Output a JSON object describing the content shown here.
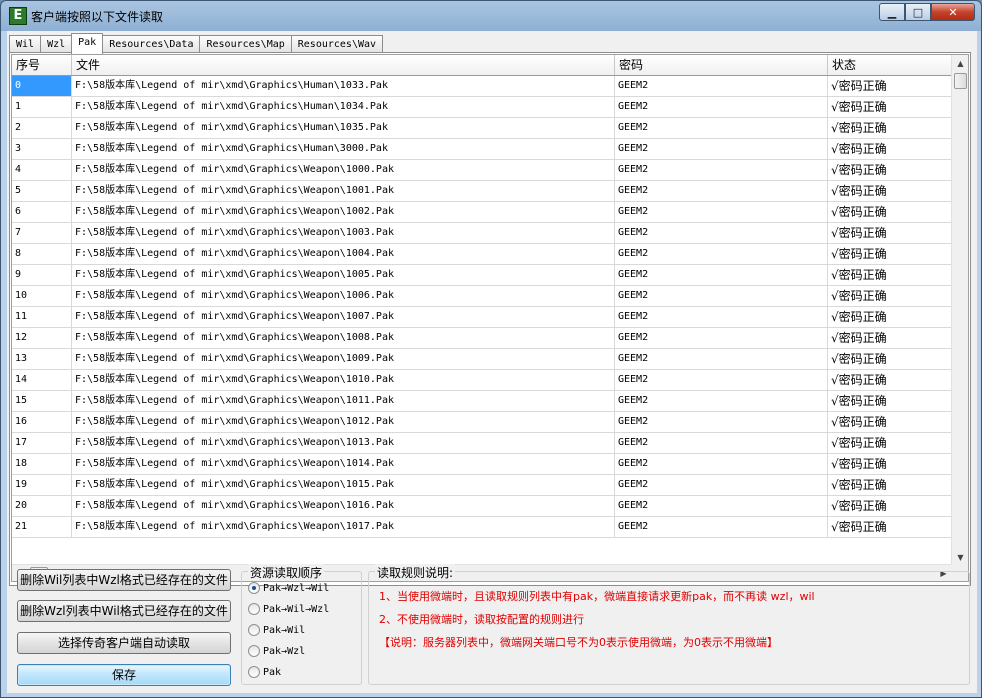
{
  "window": {
    "title": "客户端按照以下文件读取",
    "min": "▁",
    "max": "□",
    "close": "✕"
  },
  "tabs": [
    {
      "label": "Wil",
      "active": false
    },
    {
      "label": "Wzl",
      "active": false
    },
    {
      "label": "Pak",
      "active": true
    },
    {
      "label": "Resources\\Data",
      "active": false
    },
    {
      "label": "Resources\\Map",
      "active": false
    },
    {
      "label": "Resources\\Wav",
      "active": false
    }
  ],
  "grid": {
    "headers": [
      "序号",
      "文件",
      "密码",
      "状态"
    ],
    "rows": [
      [
        "0",
        "F:\\58版本库\\Legend of mir\\xmd\\Graphics\\Human\\1033.Pak",
        "GEEM2",
        "√密码正确"
      ],
      [
        "1",
        "F:\\58版本库\\Legend of mir\\xmd\\Graphics\\Human\\1034.Pak",
        "GEEM2",
        "√密码正确"
      ],
      [
        "2",
        "F:\\58版本库\\Legend of mir\\xmd\\Graphics\\Human\\1035.Pak",
        "GEEM2",
        "√密码正确"
      ],
      [
        "3",
        "F:\\58版本库\\Legend of mir\\xmd\\Graphics\\Human\\3000.Pak",
        "GEEM2",
        "√密码正确"
      ],
      [
        "4",
        "F:\\58版本库\\Legend of mir\\xmd\\Graphics\\Weapon\\1000.Pak",
        "GEEM2",
        "√密码正确"
      ],
      [
        "5",
        "F:\\58版本库\\Legend of mir\\xmd\\Graphics\\Weapon\\1001.Pak",
        "GEEM2",
        "√密码正确"
      ],
      [
        "6",
        "F:\\58版本库\\Legend of mir\\xmd\\Graphics\\Weapon\\1002.Pak",
        "GEEM2",
        "√密码正确"
      ],
      [
        "7",
        "F:\\58版本库\\Legend of mir\\xmd\\Graphics\\Weapon\\1003.Pak",
        "GEEM2",
        "√密码正确"
      ],
      [
        "8",
        "F:\\58版本库\\Legend of mir\\xmd\\Graphics\\Weapon\\1004.Pak",
        "GEEM2",
        "√密码正确"
      ],
      [
        "9",
        "F:\\58版本库\\Legend of mir\\xmd\\Graphics\\Weapon\\1005.Pak",
        "GEEM2",
        "√密码正确"
      ],
      [
        "10",
        "F:\\58版本库\\Legend of mir\\xmd\\Graphics\\Weapon\\1006.Pak",
        "GEEM2",
        "√密码正确"
      ],
      [
        "11",
        "F:\\58版本库\\Legend of mir\\xmd\\Graphics\\Weapon\\1007.Pak",
        "GEEM2",
        "√密码正确"
      ],
      [
        "12",
        "F:\\58版本库\\Legend of mir\\xmd\\Graphics\\Weapon\\1008.Pak",
        "GEEM2",
        "√密码正确"
      ],
      [
        "13",
        "F:\\58版本库\\Legend of mir\\xmd\\Graphics\\Weapon\\1009.Pak",
        "GEEM2",
        "√密码正确"
      ],
      [
        "14",
        "F:\\58版本库\\Legend of mir\\xmd\\Graphics\\Weapon\\1010.Pak",
        "GEEM2",
        "√密码正确"
      ],
      [
        "15",
        "F:\\58版本库\\Legend of mir\\xmd\\Graphics\\Weapon\\1011.Pak",
        "GEEM2",
        "√密码正确"
      ],
      [
        "16",
        "F:\\58版本库\\Legend of mir\\xmd\\Graphics\\Weapon\\1012.Pak",
        "GEEM2",
        "√密码正确"
      ],
      [
        "17",
        "F:\\58版本库\\Legend of mir\\xmd\\Graphics\\Weapon\\1013.Pak",
        "GEEM2",
        "√密码正确"
      ],
      [
        "18",
        "F:\\58版本库\\Legend of mir\\xmd\\Graphics\\Weapon\\1014.Pak",
        "GEEM2",
        "√密码正确"
      ],
      [
        "19",
        "F:\\58版本库\\Legend of mir\\xmd\\Graphics\\Weapon\\1015.Pak",
        "GEEM2",
        "√密码正确"
      ],
      [
        "20",
        "F:\\58版本库\\Legend of mir\\xmd\\Graphics\\Weapon\\1016.Pak",
        "GEEM2",
        "√密码正确"
      ],
      [
        "21",
        "F:\\58版本库\\Legend of mir\\xmd\\Graphics\\Weapon\\1017.Pak",
        "GEEM2",
        "√密码正确"
      ]
    ],
    "selected_row": 0
  },
  "buttons": {
    "delete_wil": "删除Wil列表中Wzl格式已经存在的文件",
    "delete_wzl": "删除Wzl列表中Wil格式已经存在的文件",
    "auto_read": "选择传奇客户端自动读取",
    "save": "保存"
  },
  "order_group": {
    "title": "资源读取顺序",
    "options": [
      "Pak→Wzl→Wil",
      "Pak→Wil→Wzl",
      "Pak→Wil",
      "Pak→Wzl",
      "Pak"
    ],
    "selected": 0
  },
  "rules_group": {
    "title": "读取规则说明:",
    "lines": [
      "1、当使用微端时，且读取规则列表中有pak，微端直接请求更新pak，而不再读 wzl，wil",
      "2、不使用微端时，读取按配置的规则进行",
      "【说明：服务器列表中，微端网关端口号不为0表示使用微端，为0表示不用微端】"
    ],
    "color": "#e00000"
  }
}
